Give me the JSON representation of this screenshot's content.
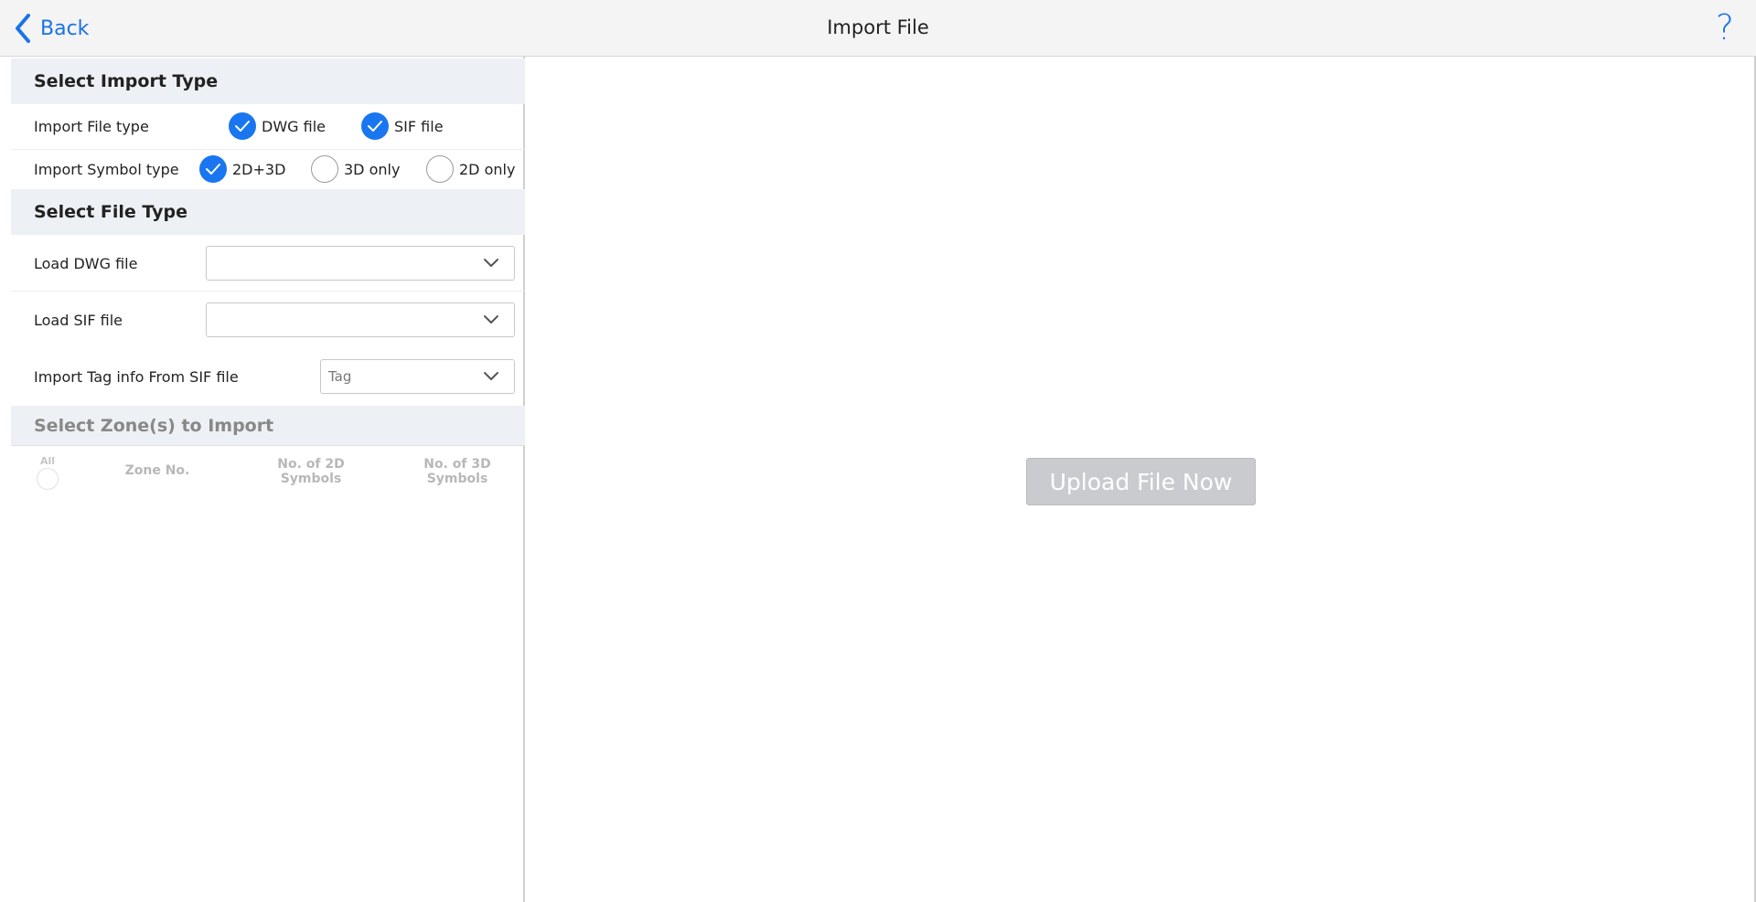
{
  "header": {
    "back_label": "Back",
    "title": "Import File",
    "help_label": "?"
  },
  "import_type": {
    "heading": "Select Import Type",
    "file_type_label": "Import File type",
    "file_type_options": [
      {
        "label": "DWG file",
        "checked": true
      },
      {
        "label": "SIF file",
        "checked": true
      }
    ],
    "symbol_type_label": "Import Symbol type",
    "symbol_type_options": [
      {
        "label": "2D+3D",
        "checked": true
      },
      {
        "label": "3D only",
        "checked": false
      },
      {
        "label": "2D only",
        "checked": false
      }
    ]
  },
  "file_type": {
    "heading": "Select File Type",
    "dwg_label": "Load DWG file",
    "dwg_value": "",
    "sif_label": "Load SIF file",
    "sif_value": "",
    "tag_label": "Import Tag info From SIF file",
    "tag_value": "Tag"
  },
  "zones": {
    "heading": "Select Zone(s) to Import",
    "all_label": "All",
    "columns": [
      "Zone No.",
      "No. of 2D\nSymbols",
      "No. of 3D\nSymbols"
    ]
  },
  "upload_button_label": "Upload File Now",
  "colors": {
    "accent": "#1976f0",
    "link": "#1a73e8",
    "header_bg": "#f4f4f4",
    "section_bg": "#edf0f4",
    "disabled_button": "#c9cbcf"
  }
}
